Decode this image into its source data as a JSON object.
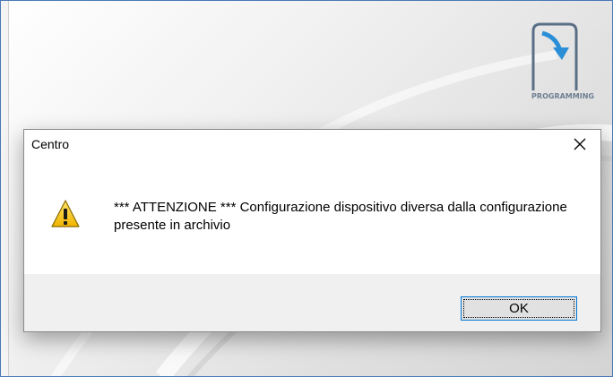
{
  "app": {
    "logo_label": "PROGRAMMING"
  },
  "dialog": {
    "title": "Centro",
    "close_glyph": "✕",
    "icon": "warning-icon",
    "message": "*** ATTENZIONE *** Configurazione dispositivo diversa dalla configurazione presente in archivio",
    "ok_label": "OK"
  },
  "colors": {
    "window_border": "#4a78b8",
    "button_focus_border": "#0078d7",
    "footer_background": "#f0f0f0",
    "warning_yellow": "#f3c20d"
  }
}
